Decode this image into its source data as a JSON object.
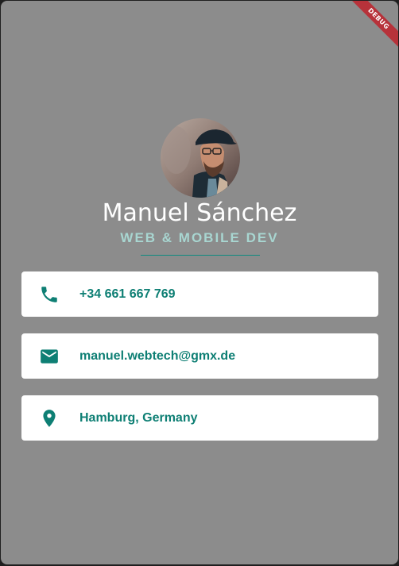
{
  "debug_banner": "DEBUG",
  "profile": {
    "name": "Manuel Sánchez",
    "title": "WEB & MOBILE DEV"
  },
  "contacts": {
    "phone": {
      "icon": "phone-icon",
      "label": "+34 661 667 769"
    },
    "email": {
      "icon": "email-icon",
      "label": "manuel.webtech@gmx.de"
    },
    "location": {
      "icon": "location-pin-icon",
      "label": "Hamburg, Germany"
    }
  },
  "colors": {
    "background": "#8c8c8c",
    "accent": "#0e8a7f",
    "title_text": "#a8d6d1",
    "debug_banner": "#b7323a",
    "card": "#ffffff"
  }
}
